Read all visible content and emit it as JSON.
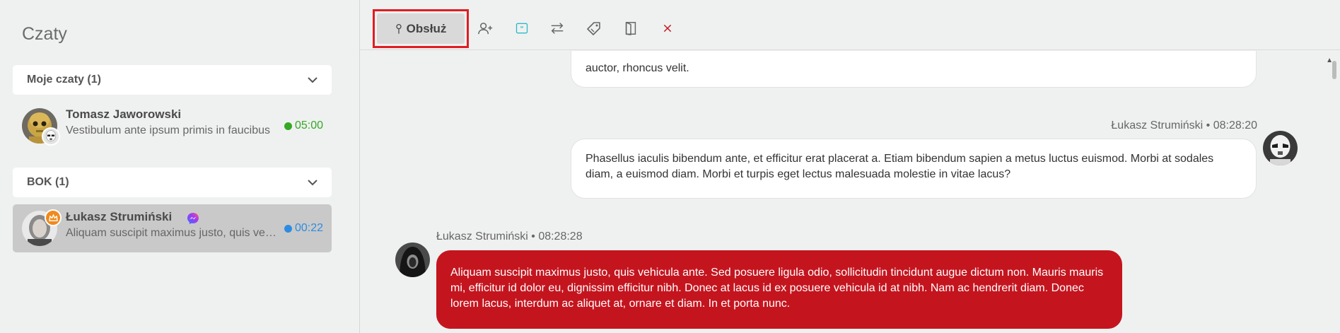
{
  "sidebar": {
    "title": "Czaty",
    "groups": [
      {
        "label": "Moje czaty (1)",
        "chats": [
          {
            "name": "Tomasz Jaworowski",
            "preview": "Vestibulum ante ipsum primis in faucibus",
            "time": "05:00",
            "status_color": "#35a824"
          }
        ]
      },
      {
        "label": "BOK (1)",
        "chats": [
          {
            "name": "Łukasz Strumiński",
            "preview": "Aliquam suscipit maximus justo, quis vehicula",
            "time": "00:22",
            "status_color": "#2e8ce0",
            "channel_icon": "messenger-icon",
            "badge_icon": "crown-icon"
          }
        ]
      }
    ]
  },
  "toolbar": {
    "handle_label": "Obsłuż",
    "icons": [
      "pin-icon",
      "add-user-icon",
      "quote-icon",
      "transfer-icon",
      "tag-icon",
      "exit-door-icon",
      "close-icon"
    ]
  },
  "messages": [
    {
      "direction": "in",
      "text": "auctor, rhoncus velit."
    },
    {
      "direction": "in",
      "author_line": "Łukasz Strumiński • 08:28:20",
      "text": "Phasellus iaculis bibendum ante, et efficitur erat placerat a. Etiam bibendum sapien a metus luctus euismod. Morbi at sodales diam, a euismod diam. Morbi et turpis eget lectus malesuada molestie in vitae lacus?"
    },
    {
      "direction": "out",
      "author_line": "Łukasz Strumiński • 08:28:28",
      "text": "Aliquam suscipit maximus justo, quis vehicula ante. Sed posuere ligula odio, sollicitudin tincidunt augue dictum non. Mauris mauris mi, efficitur id dolor eu, dignissim efficitur nibh. Donec at lacus id ex posuere vehicula id at nibh. Nam ac hendrerit diam. Donec lorem lacus, interdum ac aliquet at, ornare et diam. In et porta nunc."
    }
  ],
  "colors": {
    "accent_red": "#c4151f",
    "highlight_border": "#e01d24",
    "online_green": "#35a824",
    "waiting_blue": "#2e8ce0"
  }
}
